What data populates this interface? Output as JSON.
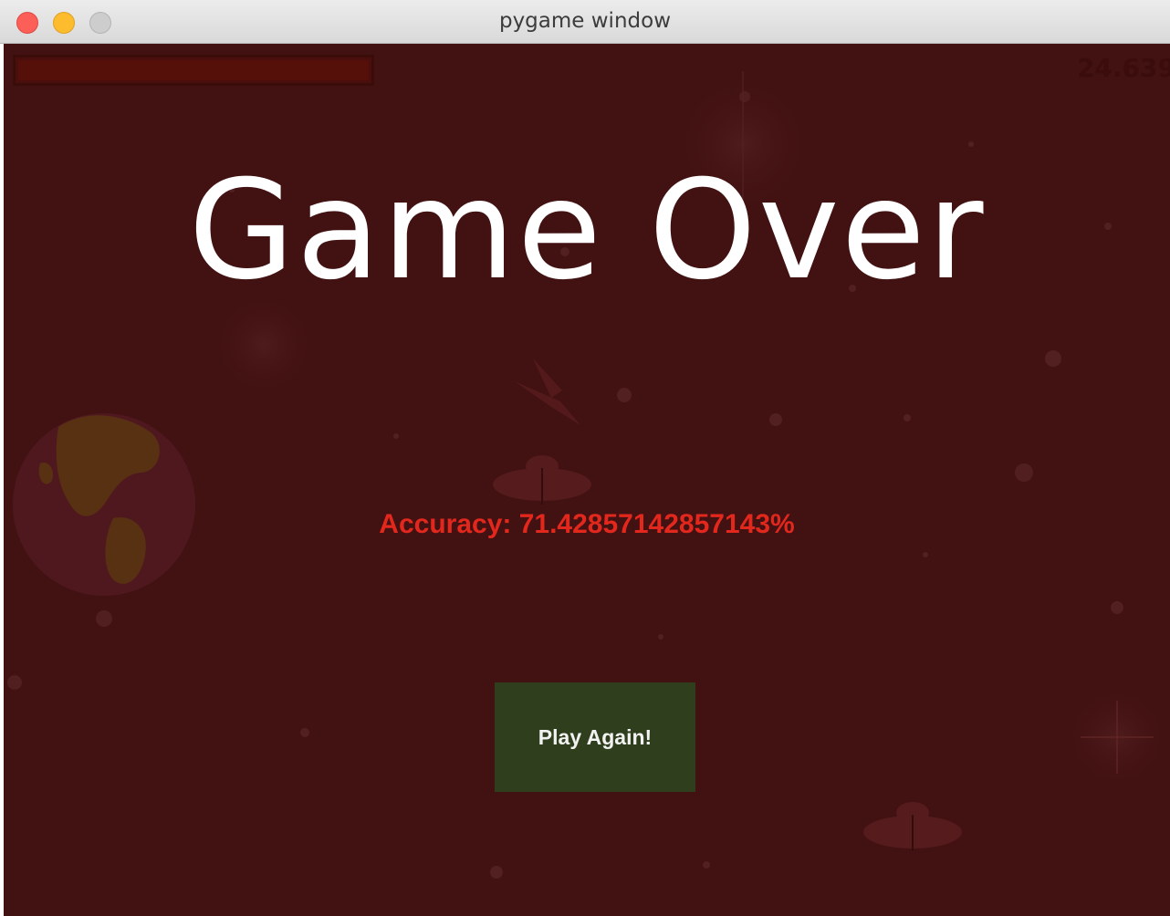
{
  "window": {
    "title": "pygame window"
  },
  "hud": {
    "score": "24.639",
    "health_fraction": 1.0
  },
  "game_over": {
    "title": "Game Over",
    "accuracy_label": "Accuracy:",
    "accuracy_value": "71.42857142857143%",
    "play_again_label": "Play Again!"
  },
  "colors": {
    "background": "#421112",
    "title_text": "#ffffff",
    "accuracy_text": "#e2271c",
    "button_fill": "#2f3e1c",
    "button_text": "#f2f2f2"
  },
  "icons": {
    "background_planet": "earth-icon",
    "background_ship_1": "ufo-icon",
    "background_ship_2": "ufo-icon",
    "background_ship_3": "rocket-icon"
  }
}
